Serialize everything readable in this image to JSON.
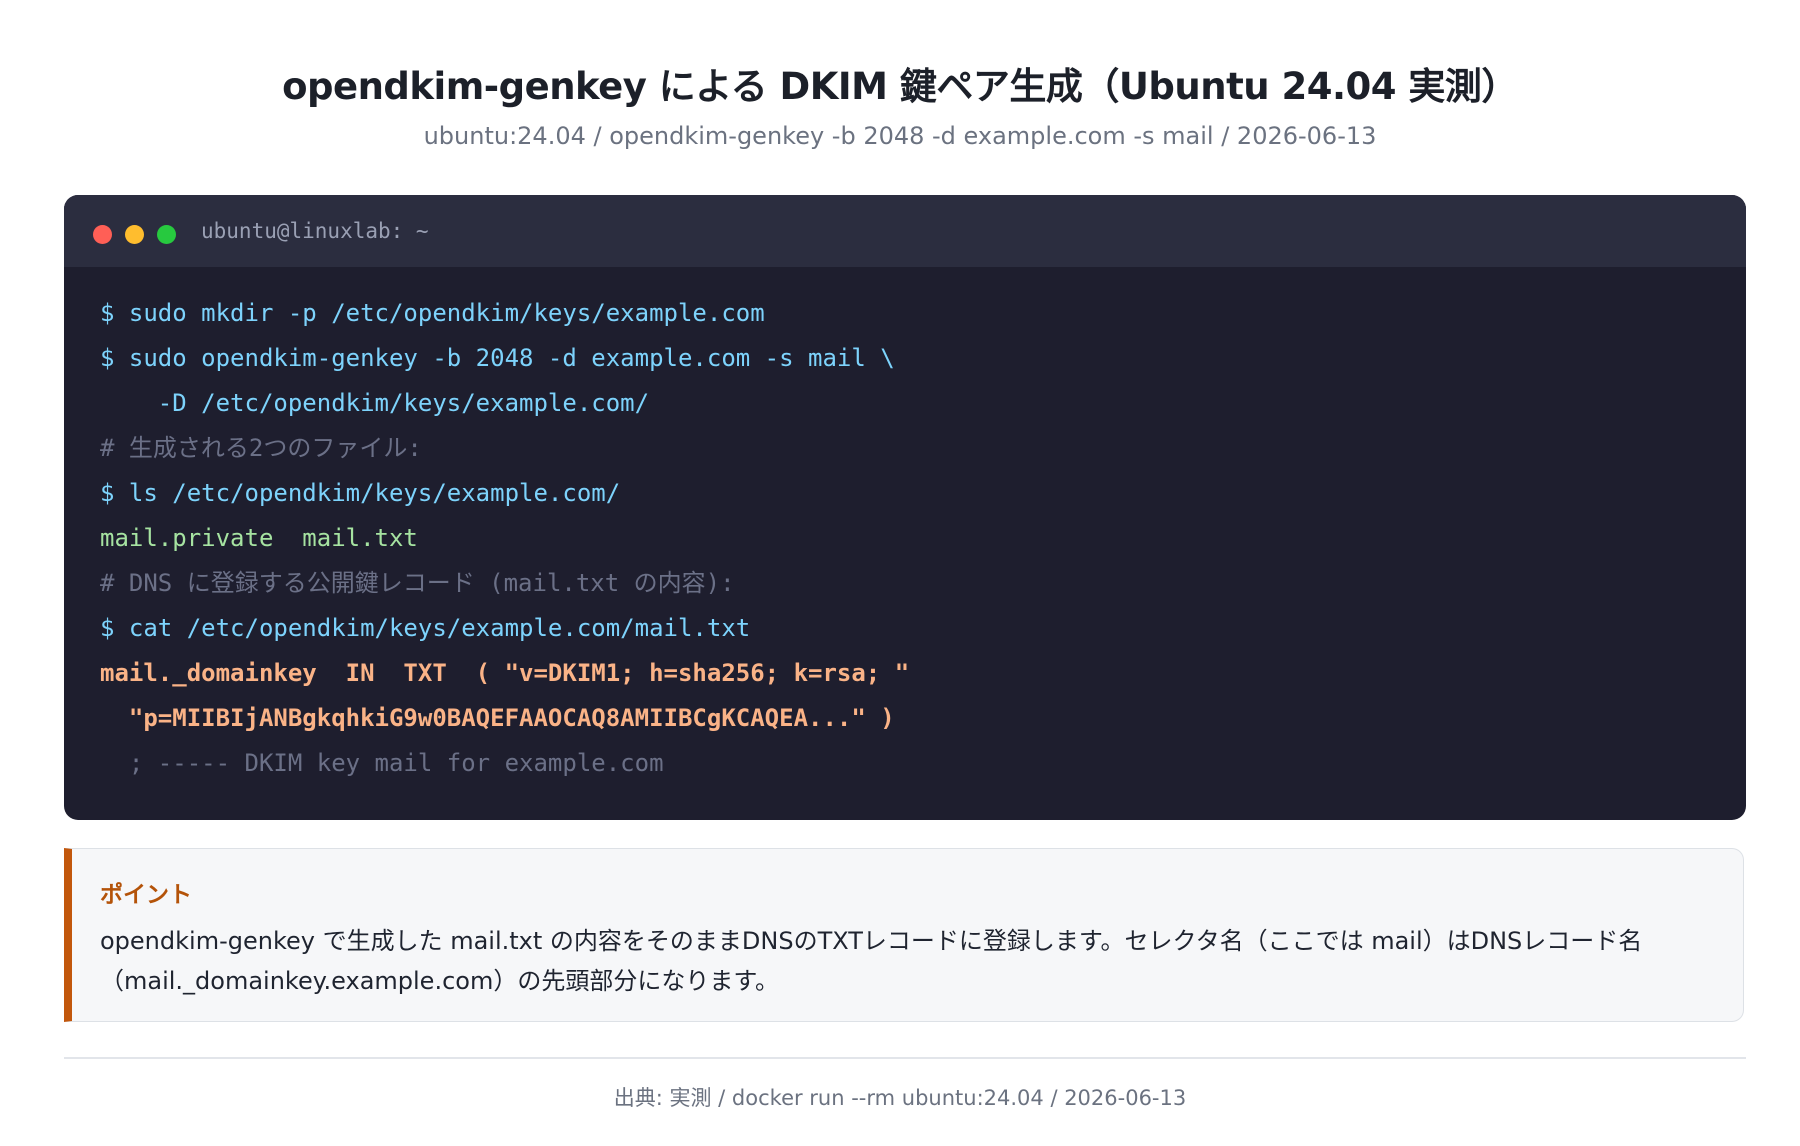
{
  "header": {
    "title": "opendkim-genkey による DKIM 鍵ペア生成（Ubuntu 24.04 実測）",
    "subtitle": "ubuntu:24.04 / opendkim-genkey -b 2048 -d example.com -s mail / 2026-06-13"
  },
  "terminal": {
    "window_title": "ubuntu@linuxlab: ~",
    "buttons": [
      "close",
      "minimize",
      "maximize"
    ],
    "lines": [
      {
        "kind": "command",
        "text": "$ sudo mkdir -p /etc/opendkim/keys/example.com"
      },
      {
        "kind": "command",
        "text": "$ sudo opendkim-genkey -b 2048 -d example.com -s mail \\"
      },
      {
        "kind": "command",
        "text": "    -D /etc/opendkim/keys/example.com/"
      },
      {
        "kind": "comment",
        "text": "# 生成される2つのファイル:"
      },
      {
        "kind": "command",
        "text": "$ ls /etc/opendkim/keys/example.com/"
      },
      {
        "kind": "output",
        "text": "mail.private  mail.txt"
      },
      {
        "kind": "comment",
        "text": "# DNS に登録する公開鍵レコード (mail.txt の内容):"
      },
      {
        "kind": "command",
        "text": "$ cat /etc/opendkim/keys/example.com/mail.txt"
      },
      {
        "kind": "record",
        "text": "mail._domainkey  IN  TXT  ( \"v=DKIM1; h=sha256; k=rsa; \""
      },
      {
        "kind": "record",
        "text": "  \"p=MIIBIjANBgkqhkiG9w0BAQEFAAOCAQ8AMIIBCgKCAQEA...\" )"
      },
      {
        "kind": "comment",
        "text": "  ; ----- DKIM key mail for example.com"
      }
    ]
  },
  "point": {
    "label": "ポイント",
    "text": "opendkim-genkey で生成した mail.txt の内容をそのままDNSのTXTレコードに登録します。セレクタ名（ここでは mail）はDNSレコード名（mail._domainkey.example.com）の先頭部分になります。"
  },
  "footer": {
    "source": "出典: 実測 / docker run --rm ubuntu:24.04 / 2026-06-13"
  },
  "colors": {
    "terminal_bg": "#1e1e2e",
    "command": "#7dd3fc",
    "comment": "#6b7087",
    "output": "#a6e3a1",
    "record": "#fab387",
    "accent": "#c2570c"
  }
}
